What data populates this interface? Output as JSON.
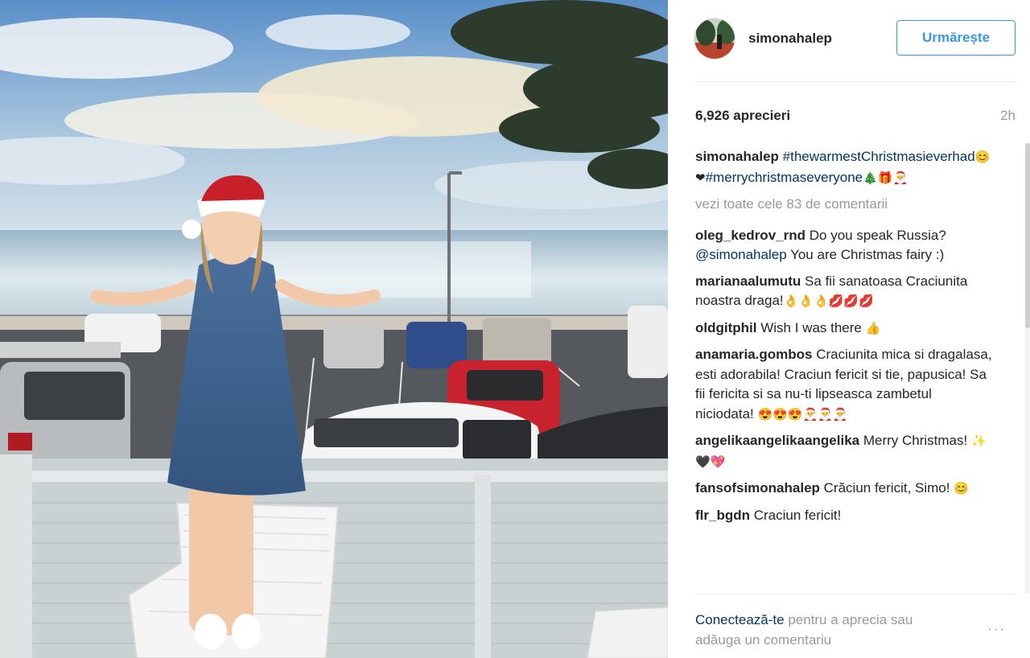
{
  "post": {
    "username": "simonahalep",
    "follow_label": "Urmărește",
    "likes": "6,926 aprecieri",
    "time": "2h"
  },
  "caption": {
    "user": "simonahalep",
    "tags": "#thewarmestChristmasieverhad",
    "emoji1": "😊❤",
    "tags2": "#merrychristmaseveryone",
    "emoji2": "🎄🎁🎅"
  },
  "view_all": "vezi toate cele 83 de comentarii",
  "comments": [
    {
      "user": "oleg_kedrov_rnd",
      "text": "Do you speak Russia?",
      "mention": "@simonahalep",
      "text2": "You are Christmas fairy :)"
    },
    {
      "user": "marianaalumutu",
      "text": "Sa fii sanatoasa Craciunita noastra draga!",
      "emoji": "👌👌👌💋💋💋"
    },
    {
      "user": "oldgitphil",
      "text": "Wish I was there",
      "emoji": "👍"
    },
    {
      "user": "anamaria.gombos",
      "text": "Craciunita mica si dragalasa, esti adorabila! Craciun fericit si tie, papusica! Sa fii fericita si sa nu-ti lipseasca zambetul niciodata!",
      "emoji": "😍😍😍🎅🎅🎅"
    },
    {
      "user": "angelikaangelikaangelika",
      "text": "Merry Christmas!",
      "emoji": "✨🖤💖"
    },
    {
      "user": "fansofsimonahalep",
      "text": "Crăciun fericit, Simo!",
      "emoji": "😊"
    },
    {
      "user": "flr_bgdn",
      "text": "Craciun fericit!"
    }
  ],
  "footer": {
    "login_link": "Conectează-te",
    "login_text": "pentru a aprecia sau adăuga un comentariu",
    "more_label": "···"
  },
  "icons": {
    "more": "more-options-icon"
  },
  "colors": {
    "link": "#003569",
    "follow": "#3897f0",
    "muted": "#999999"
  }
}
